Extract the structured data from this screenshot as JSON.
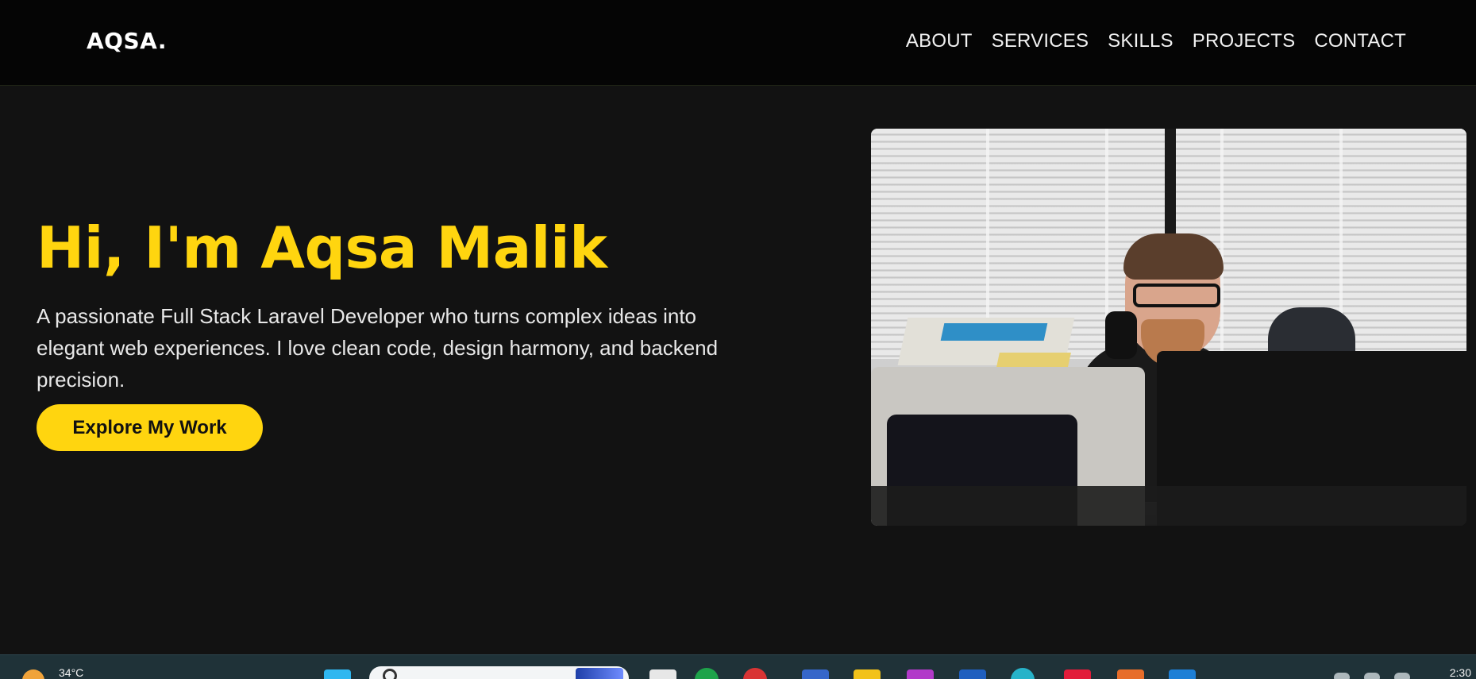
{
  "site": {
    "logo": "AQSA.",
    "nav": [
      {
        "label": "ABOUT"
      },
      {
        "label": "SERVICES"
      },
      {
        "label": "SKILLS"
      },
      {
        "label": "PROJECTS"
      },
      {
        "label": "CONTACT"
      }
    ]
  },
  "hero": {
    "title": "Hi, I'm Aqsa Malik",
    "description": "A passionate Full Stack Laravel Developer who turns complex ideas into elegant web experiences. I love clean code, design harmony, and backend precision.",
    "cta_label": "Explore My Work",
    "accent_color": "#ffd50f"
  },
  "taskbar": {
    "weather_temp": "34°C",
    "search_placeholder": "",
    "clock_time": "2:30"
  }
}
